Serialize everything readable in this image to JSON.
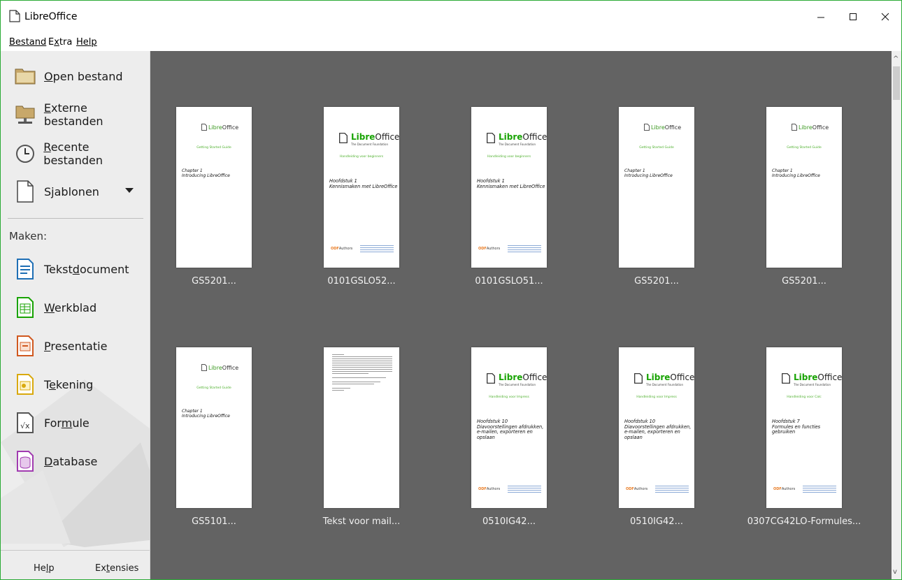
{
  "window": {
    "title": "LibreOffice"
  },
  "menu": {
    "file": "Bestand",
    "tools": "Extra",
    "help": "Help"
  },
  "sidebar": {
    "open_file": "Open bestand",
    "remote_files": "Externe bestanden",
    "recent_files": "Recente bestanden",
    "templates": "Sjablonen",
    "create_label": "Maken:",
    "create": {
      "writer": "Tekstdocument",
      "calc": "Werkblad",
      "impress": "Presentatie",
      "draw": "Tekening",
      "math": "Formule",
      "base": "Database"
    },
    "footer": {
      "help": "Help",
      "extensions": "Extensies"
    }
  },
  "brand": {
    "libre": "Libre",
    "office": "Office",
    "foundation": "The Document Foundation",
    "odf": "ODF",
    "authors": "Authors"
  },
  "thumbnails": [
    {
      "name": "GS5201...",
      "subtitle": "Getting Started Guide",
      "chapter_line1": "Chapter 1",
      "chapter_line2": "Introducing LibreOffice"
    },
    {
      "name": "0101GSLO52...",
      "subtitle": "Handleiding voor beginners",
      "chapter_line1": "Hoofdstuk 1",
      "chapter_line2": "Kennismaken met LibreOffice"
    },
    {
      "name": "0101GSLO51...",
      "subtitle": "Handleiding voor beginners",
      "chapter_line1": "Hoofdstuk 1",
      "chapter_line2": "Kennismaken met LibreOffice"
    },
    {
      "name": "GS5201...",
      "subtitle": "Getting Started Guide",
      "chapter_line1": "Chapter 1",
      "chapter_line2": "Introducing LibreOffice"
    },
    {
      "name": "GS5201...",
      "subtitle": "Getting Started Guide",
      "chapter_line1": "Chapter 1",
      "chapter_line2": "Introducing LibreOffice"
    },
    {
      "name": "GS5101...",
      "subtitle": "Getting Started Guide",
      "chapter_line1": "Chapter 1",
      "chapter_line2": "Introducing LibreOffice"
    },
    {
      "name": "Tekst voor mail..."
    },
    {
      "name": "0510IG42...",
      "subtitle": "Handleiding voor Impress",
      "chapter_line1": "Hoofdstuk 10",
      "chapter_line2": "Diavoorstellingen afdrukken,",
      "chapter_line3": "e-mailen, exporteren en",
      "chapter_line4": "opslaan"
    },
    {
      "name": "0510IG42...",
      "subtitle": "Handleiding voor Impress",
      "chapter_line1": "Hoofdstuk 10",
      "chapter_line2": "Diavoorstellingen afdrukken,",
      "chapter_line3": "e-mailen, exporteren en",
      "chapter_line4": "opslaan"
    },
    {
      "name": "0307CG42LO-Formules...",
      "subtitle": "Handleiding voor Calc",
      "chapter_line1": "Hoofdstuk 7",
      "chapter_line2": "Formules en functies",
      "chapter_line3": "gebruiken"
    }
  ],
  "colors": {
    "accent_green": "#18a303",
    "main_bg": "#636363",
    "sidebar_bg": "#ededed"
  }
}
